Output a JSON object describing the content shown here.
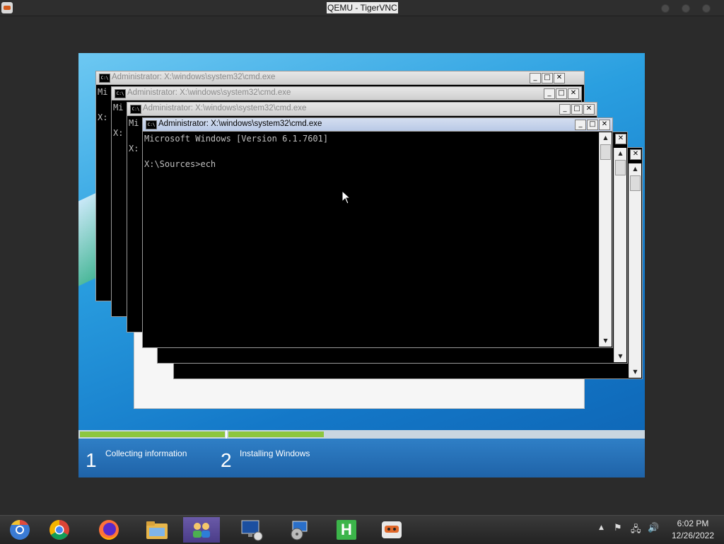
{
  "vnc": {
    "title": "QEMU - TigerVNC"
  },
  "cmd_windows": [
    {
      "title": "Administrator: X:\\windows\\system32\\cmd.exe",
      "partial": "Mi",
      "prompt_partial": "X:"
    },
    {
      "title": "Administrator: X:\\windows\\system32\\cmd.exe",
      "partial": "Mi",
      "prompt_partial": "X:"
    },
    {
      "title": "Administrator: X:\\windows\\system32\\cmd.exe",
      "partial": "Mi",
      "prompt_partial": "X:"
    },
    {
      "title": "Administrator: X:\\windows\\system32\\cmd.exe",
      "line1": "Microsoft Windows [Version 6.1.7601]",
      "line2": "X:\\Sources>ech"
    }
  ],
  "window_buttons": {
    "minimize": "_",
    "maximize": "□",
    "close": "✕"
  },
  "setup": {
    "progress": 0.43,
    "steps": [
      {
        "num": "1",
        "label": "Collecting information"
      },
      {
        "num": "2",
        "label": "Installing Windows"
      }
    ]
  },
  "taskbar": {
    "apps": [
      {
        "name": "chromium",
        "icon": "chromium-icon"
      },
      {
        "name": "chrome",
        "icon": "chrome-icon"
      },
      {
        "name": "firefox",
        "icon": "firefox-icon"
      },
      {
        "name": "file-manager",
        "icon": "folder-icon"
      },
      {
        "name": "network-users",
        "icon": "users-icon"
      },
      {
        "name": "remote-desktop",
        "icon": "monitor-icon"
      },
      {
        "name": "installer",
        "icon": "installer-icon"
      },
      {
        "name": "h-app",
        "icon": "h-icon",
        "letter": "H"
      },
      {
        "name": "tigervnc",
        "icon": "vnc-icon"
      }
    ],
    "tray": {
      "up_arrow": "▲",
      "flag": "⚑",
      "network": "🖧",
      "volume": "🔊"
    },
    "clock": {
      "time": "6:02 PM",
      "date": "12/26/2022"
    }
  },
  "colors": {
    "accent_green": "#8dc63f",
    "setup_blue": "#1f63a8"
  }
}
